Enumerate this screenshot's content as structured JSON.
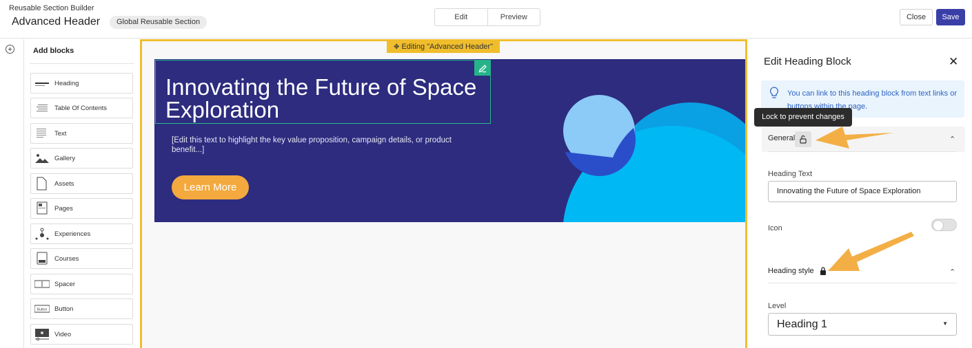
{
  "header": {
    "app_subtitle": "Reusable Section Builder",
    "title": "Advanced Header",
    "badge": "Global Reusable Section",
    "mode_tabs": [
      "Edit",
      "Preview"
    ],
    "close_label": "Close",
    "save_label": "Save",
    "save_color": "#3a3fa8"
  },
  "blocks_panel": {
    "title": "Add blocks",
    "items": [
      {
        "label": "Heading",
        "icon": "heading-icon"
      },
      {
        "label": "Table Of Contents",
        "icon": "table-of-contents-icon"
      },
      {
        "label": "Text",
        "icon": "text-icon"
      },
      {
        "label": "Gallery",
        "icon": "gallery-icon"
      },
      {
        "label": "Assets",
        "icon": "assets-icon"
      },
      {
        "label": "Pages",
        "icon": "pages-icon"
      },
      {
        "label": "Experiences",
        "icon": "experiences-icon"
      },
      {
        "label": "Courses",
        "icon": "courses-icon"
      },
      {
        "label": "Spacer",
        "icon": "spacer-icon"
      },
      {
        "label": "Button",
        "icon": "button-icon"
      },
      {
        "label": "Video",
        "icon": "video-icon"
      }
    ],
    "button_icon_text": "Button"
  },
  "canvas": {
    "editing_tag": "Editing \"Advanced Header\"",
    "hero_heading": "Innovating the Future of Space Exploration",
    "hero_text": "[Edit this text to highlight the key value proposition, campaign details, or product benefit...]",
    "hero_button": "Learn More",
    "hero_bg": "#2d2c7f",
    "accent_border": "#f0be2c"
  },
  "editor": {
    "title": "Edit Heading Block",
    "info": "You can link to this heading block from text links or buttons within the page.",
    "tooltip": "Lock to prevent changes",
    "general_label": "General",
    "heading_text_label": "Heading Text",
    "heading_text_value": "Innovating the Future of Space Exploration",
    "icon_label": "Icon",
    "icon_toggle_on": false,
    "heading_style_label": "Heading style",
    "level_label": "Level",
    "level_value": "Heading 1"
  }
}
